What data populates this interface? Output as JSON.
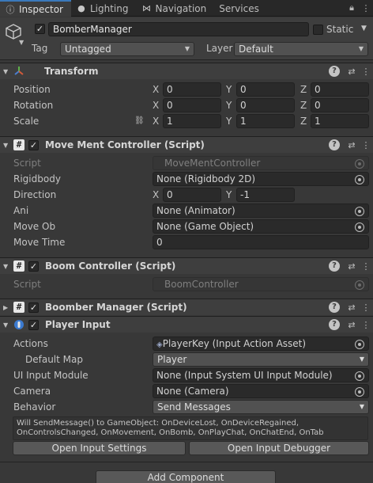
{
  "tabs": [
    {
      "label": "Inspector",
      "icon": "info-icon"
    },
    {
      "label": "Lighting",
      "icon": "bulb-icon"
    },
    {
      "label": "Navigation",
      "icon": "navigation-icon"
    },
    {
      "label": "Services",
      "icon": ""
    }
  ],
  "object": {
    "name": "BomberManager",
    "active": true,
    "static_label": "Static",
    "static": false,
    "tag_label": "Tag",
    "tag_value": "Untagged",
    "layer_label": "Layer",
    "layer_value": "Default"
  },
  "transform": {
    "title": "Transform",
    "position": {
      "label": "Position",
      "x": "0",
      "y": "0",
      "z": "0"
    },
    "rotation": {
      "label": "Rotation",
      "x": "0",
      "y": "0",
      "z": "0"
    },
    "scale": {
      "label": "Scale",
      "x": "1",
      "y": "1",
      "z": "1"
    },
    "axis_x": "X",
    "axis_y": "Y",
    "axis_z": "Z"
  },
  "movement": {
    "title": "Move Ment Controller (Script)",
    "script_label": "Script",
    "script_value": "MoveMentController",
    "rigidbody_label": "Rigidbody",
    "rigidbody_value": "None (Rigidbody 2D)",
    "direction_label": "Direction",
    "direction_x": "0",
    "direction_y": "-1",
    "ani_label": "Ani",
    "ani_value": "None (Animator)",
    "moveob_label": "Move Ob",
    "moveob_value": "None (Game Object)",
    "movetime_label": "Move Time",
    "movetime_value": "0"
  },
  "boom": {
    "title": "Boom Controller (Script)",
    "script_label": "Script",
    "script_value": "BoomController"
  },
  "bomber": {
    "title": "Boomber Manager (Script)"
  },
  "player_input": {
    "title": "Player Input",
    "actions_label": "Actions",
    "actions_value": "PlayerKey (Input Action Asset)",
    "defaultmap_label": "Default Map",
    "defaultmap_value": "Player",
    "uimodule_label": "UI Input Module",
    "uimodule_value": "None (Input System UI Input Module)",
    "camera_label": "Camera",
    "camera_value": "None (Camera)",
    "behavior_label": "Behavior",
    "behavior_value": "Send Messages",
    "help_line1": "Will SendMessage() to GameObject: OnDeviceLost, OnDeviceRegained,",
    "help_line2": "OnControlsChanged, OnMovement, OnBomb, OnPlayChat, OnChatEnd, OnTab",
    "open_settings": "Open Input Settings",
    "open_debugger": "Open Input Debugger"
  },
  "add_component": "Add Component",
  "colors": {
    "background": "#383838",
    "header": "#3e3e3e",
    "field": "#2a2a2a",
    "accent": "#3a79bb",
    "text": "#c4c4c4"
  }
}
